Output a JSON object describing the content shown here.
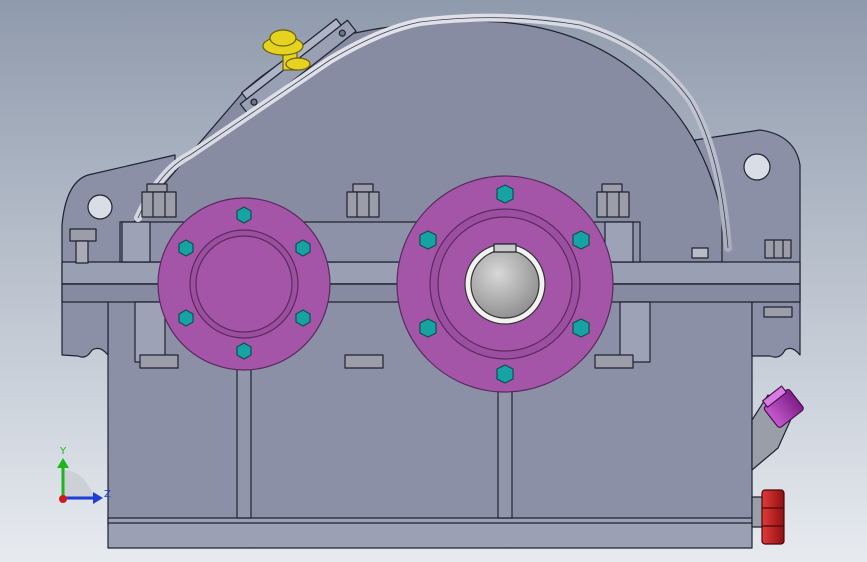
{
  "scene": {
    "kind": "cad-assembly-view",
    "subject": "gear-reducer-housing",
    "colors": {
      "background_top": "#8f9aac",
      "background_bottom": "#e7ebf0",
      "housing": "#8b90a6",
      "housing_light": "#a3a8bb",
      "housing_dark": "#6e7388",
      "edge": "#1f2230",
      "flange": "#a455a8",
      "flange_edge": "#5a2a5e",
      "bolt_head": "#17a3a3",
      "hex_nut": "#9b9ea8",
      "shaft": "#b5b5b5",
      "breather_cap": "#e5d31f",
      "oil_gauge": "#b83db8",
      "drain_plug": "#c31d1d",
      "pipe": "#d8dbe6"
    }
  },
  "triad": {
    "axes": [
      {
        "name": "y",
        "label": "Y",
        "color": "#1fb51f"
      },
      {
        "name": "z",
        "label": "Z",
        "color": "#1d3fd6"
      },
      {
        "name": "origin",
        "label": "",
        "color": "#d01818"
      }
    ]
  }
}
